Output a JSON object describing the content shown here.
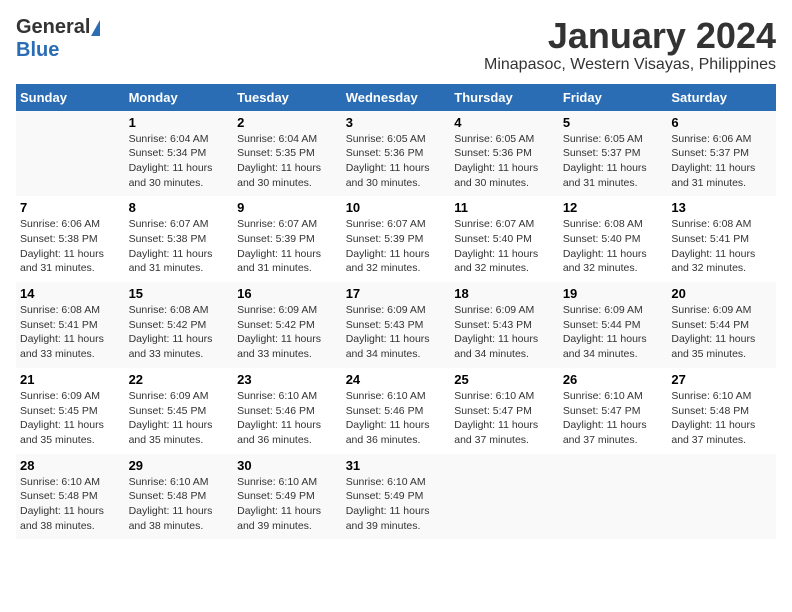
{
  "header": {
    "logo_general": "General",
    "logo_blue": "Blue",
    "title": "January 2024",
    "subtitle": "Minapasoc, Western Visayas, Philippines"
  },
  "weekdays": [
    "Sunday",
    "Monday",
    "Tuesday",
    "Wednesday",
    "Thursday",
    "Friday",
    "Saturday"
  ],
  "weeks": [
    [
      {
        "day": "",
        "content": ""
      },
      {
        "day": "1",
        "content": "Sunrise: 6:04 AM\nSunset: 5:34 PM\nDaylight: 11 hours\nand 30 minutes."
      },
      {
        "day": "2",
        "content": "Sunrise: 6:04 AM\nSunset: 5:35 PM\nDaylight: 11 hours\nand 30 minutes."
      },
      {
        "day": "3",
        "content": "Sunrise: 6:05 AM\nSunset: 5:36 PM\nDaylight: 11 hours\nand 30 minutes."
      },
      {
        "day": "4",
        "content": "Sunrise: 6:05 AM\nSunset: 5:36 PM\nDaylight: 11 hours\nand 30 minutes."
      },
      {
        "day": "5",
        "content": "Sunrise: 6:05 AM\nSunset: 5:37 PM\nDaylight: 11 hours\nand 31 minutes."
      },
      {
        "day": "6",
        "content": "Sunrise: 6:06 AM\nSunset: 5:37 PM\nDaylight: 11 hours\nand 31 minutes."
      }
    ],
    [
      {
        "day": "7",
        "content": "Sunrise: 6:06 AM\nSunset: 5:38 PM\nDaylight: 11 hours\nand 31 minutes."
      },
      {
        "day": "8",
        "content": "Sunrise: 6:07 AM\nSunset: 5:38 PM\nDaylight: 11 hours\nand 31 minutes."
      },
      {
        "day": "9",
        "content": "Sunrise: 6:07 AM\nSunset: 5:39 PM\nDaylight: 11 hours\nand 31 minutes."
      },
      {
        "day": "10",
        "content": "Sunrise: 6:07 AM\nSunset: 5:39 PM\nDaylight: 11 hours\nand 32 minutes."
      },
      {
        "day": "11",
        "content": "Sunrise: 6:07 AM\nSunset: 5:40 PM\nDaylight: 11 hours\nand 32 minutes."
      },
      {
        "day": "12",
        "content": "Sunrise: 6:08 AM\nSunset: 5:40 PM\nDaylight: 11 hours\nand 32 minutes."
      },
      {
        "day": "13",
        "content": "Sunrise: 6:08 AM\nSunset: 5:41 PM\nDaylight: 11 hours\nand 32 minutes."
      }
    ],
    [
      {
        "day": "14",
        "content": "Sunrise: 6:08 AM\nSunset: 5:41 PM\nDaylight: 11 hours\nand 33 minutes."
      },
      {
        "day": "15",
        "content": "Sunrise: 6:08 AM\nSunset: 5:42 PM\nDaylight: 11 hours\nand 33 minutes."
      },
      {
        "day": "16",
        "content": "Sunrise: 6:09 AM\nSunset: 5:42 PM\nDaylight: 11 hours\nand 33 minutes."
      },
      {
        "day": "17",
        "content": "Sunrise: 6:09 AM\nSunset: 5:43 PM\nDaylight: 11 hours\nand 34 minutes."
      },
      {
        "day": "18",
        "content": "Sunrise: 6:09 AM\nSunset: 5:43 PM\nDaylight: 11 hours\nand 34 minutes."
      },
      {
        "day": "19",
        "content": "Sunrise: 6:09 AM\nSunset: 5:44 PM\nDaylight: 11 hours\nand 34 minutes."
      },
      {
        "day": "20",
        "content": "Sunrise: 6:09 AM\nSunset: 5:44 PM\nDaylight: 11 hours\nand 35 minutes."
      }
    ],
    [
      {
        "day": "21",
        "content": "Sunrise: 6:09 AM\nSunset: 5:45 PM\nDaylight: 11 hours\nand 35 minutes."
      },
      {
        "day": "22",
        "content": "Sunrise: 6:09 AM\nSunset: 5:45 PM\nDaylight: 11 hours\nand 35 minutes."
      },
      {
        "day": "23",
        "content": "Sunrise: 6:10 AM\nSunset: 5:46 PM\nDaylight: 11 hours\nand 36 minutes."
      },
      {
        "day": "24",
        "content": "Sunrise: 6:10 AM\nSunset: 5:46 PM\nDaylight: 11 hours\nand 36 minutes."
      },
      {
        "day": "25",
        "content": "Sunrise: 6:10 AM\nSunset: 5:47 PM\nDaylight: 11 hours\nand 37 minutes."
      },
      {
        "day": "26",
        "content": "Sunrise: 6:10 AM\nSunset: 5:47 PM\nDaylight: 11 hours\nand 37 minutes."
      },
      {
        "day": "27",
        "content": "Sunrise: 6:10 AM\nSunset: 5:48 PM\nDaylight: 11 hours\nand 37 minutes."
      }
    ],
    [
      {
        "day": "28",
        "content": "Sunrise: 6:10 AM\nSunset: 5:48 PM\nDaylight: 11 hours\nand 38 minutes."
      },
      {
        "day": "29",
        "content": "Sunrise: 6:10 AM\nSunset: 5:48 PM\nDaylight: 11 hours\nand 38 minutes."
      },
      {
        "day": "30",
        "content": "Sunrise: 6:10 AM\nSunset: 5:49 PM\nDaylight: 11 hours\nand 39 minutes."
      },
      {
        "day": "31",
        "content": "Sunrise: 6:10 AM\nSunset: 5:49 PM\nDaylight: 11 hours\nand 39 minutes."
      },
      {
        "day": "",
        "content": ""
      },
      {
        "day": "",
        "content": ""
      },
      {
        "day": "",
        "content": ""
      }
    ]
  ]
}
